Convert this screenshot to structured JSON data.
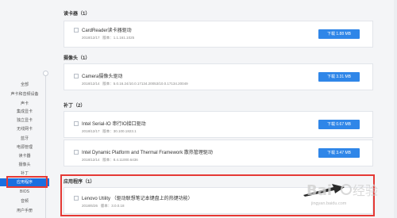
{
  "sidebar": {
    "items": [
      {
        "label": "全部",
        "active": false
      },
      {
        "label": "声卡和音频设备",
        "active": false
      },
      {
        "label": "声卡",
        "active": false
      },
      {
        "label": "集成显卡",
        "active": false
      },
      {
        "label": "独立显卡",
        "active": false
      },
      {
        "label": "无线网卡",
        "active": false
      },
      {
        "label": "蓝牙",
        "active": false
      },
      {
        "label": "电源管理",
        "active": false
      },
      {
        "label": "读卡器",
        "active": false
      },
      {
        "label": "摄像头",
        "active": false
      },
      {
        "label": "补丁",
        "active": false
      },
      {
        "label": "应用程序",
        "active": true
      },
      {
        "label": "BIOS",
        "active": false
      },
      {
        "label": "音频",
        "active": false
      },
      {
        "label": "用户手册",
        "active": false
      }
    ]
  },
  "sections": [
    {
      "title": "读卡器（1）",
      "drivers": [
        {
          "name": "CardReader读卡器驱动",
          "date": "2018/12/17",
          "version_label": "版本：",
          "version": "1.1.161.1025",
          "button": "下载 1.88 MB",
          "has_button": true
        }
      ]
    },
    {
      "title": "摄像头（1）",
      "drivers": [
        {
          "name": "Camera摄像头驱动",
          "date": "2018/12/14",
          "version_label": "版本：",
          "version": "5.0.16.24/10.0.17134.20053/10.0.17134.20049",
          "button": "下载 3.31 MB",
          "has_button": true
        }
      ]
    },
    {
      "title": "补丁（2）",
      "drivers": [
        {
          "name": "Intel Serial-IO 串行IO接口驱动",
          "date": "2018/12/17",
          "version_label": "版本：",
          "version": "30.100.1823.1",
          "button": "下载 0.67 MB",
          "has_button": true
        },
        {
          "name": "Intel Dynamic Platform and Thermal Framework 散热管理驱动",
          "date": "2018/12/14",
          "version_label": "版本：",
          "version": "8.4.11000.6436",
          "button": "下载 3.47 MB",
          "has_button": true
        }
      ]
    },
    {
      "title": "应用程序（1）",
      "drivers": [
        {
          "name": "Lenovo Utility （驱动联想笔记本键盘上的热键功能）",
          "date": "2018/6/26",
          "version_label": "版本：",
          "version": "3.0.0.18",
          "button": "",
          "has_button": false
        }
      ]
    }
  ],
  "watermark": {
    "text": "jingyan.baidu.com"
  },
  "colors": {
    "accent": "#2f86e8",
    "active_nav": "#1a6fe0",
    "highlight": "#e53935"
  }
}
